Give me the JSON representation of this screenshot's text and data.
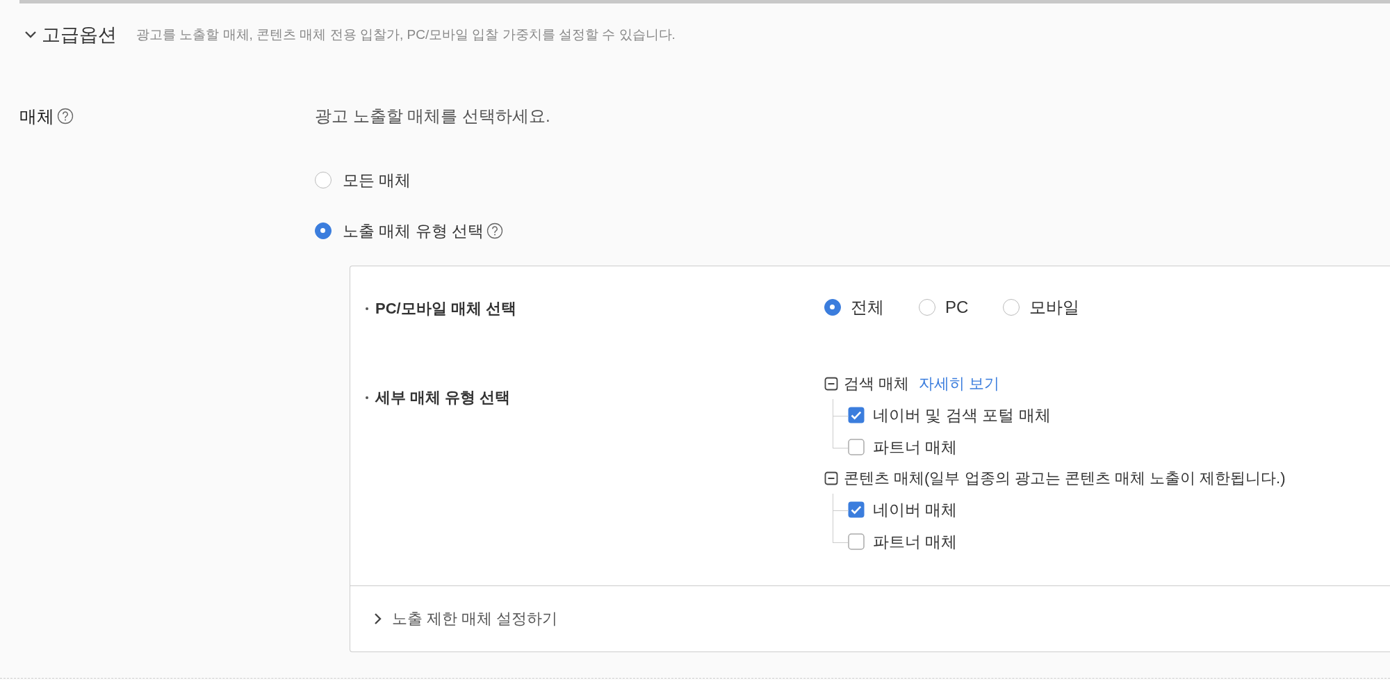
{
  "header": {
    "title": "고급옵션",
    "description": "광고를 노출할 매체, 콘텐츠 매체 전용 입찰가, PC/모바일 입찰 가중치를 설정할 수 있습니다.",
    "expanded": true
  },
  "media": {
    "label": "매체",
    "prompt": "광고 노출할 매체를 선택하세요.",
    "options": [
      {
        "label": "모든 매체",
        "selected": false,
        "help": false
      },
      {
        "label": "노출 매체 유형 선택",
        "selected": true,
        "help": true
      }
    ],
    "panel": {
      "device": {
        "label": "PC/모바일 매체 선택",
        "options": [
          {
            "label": "전체",
            "selected": true
          },
          {
            "label": "PC",
            "selected": false
          },
          {
            "label": "모바일",
            "selected": false
          }
        ]
      },
      "detail": {
        "label": "세부 매체 유형 선택",
        "groups": [
          {
            "label": "검색 매체",
            "link": "자세히 보기",
            "expanded": true,
            "children": [
              {
                "label": "네이버 및 검색 포털 매체",
                "checked": true
              },
              {
                "label": "파트너 매체",
                "checked": false
              }
            ]
          },
          {
            "label": "콘텐츠 매체(일부 업종의 광고는 콘텐츠 매체 노출이 제한됩니다.)",
            "expanded": true,
            "children": [
              {
                "label": "네이버 매체",
                "checked": true
              },
              {
                "label": "파트너 매체",
                "checked": false
              }
            ]
          }
        ]
      },
      "exclusion": {
        "label": "노출 제한 매체 설정하기",
        "expanded": false
      }
    }
  }
}
